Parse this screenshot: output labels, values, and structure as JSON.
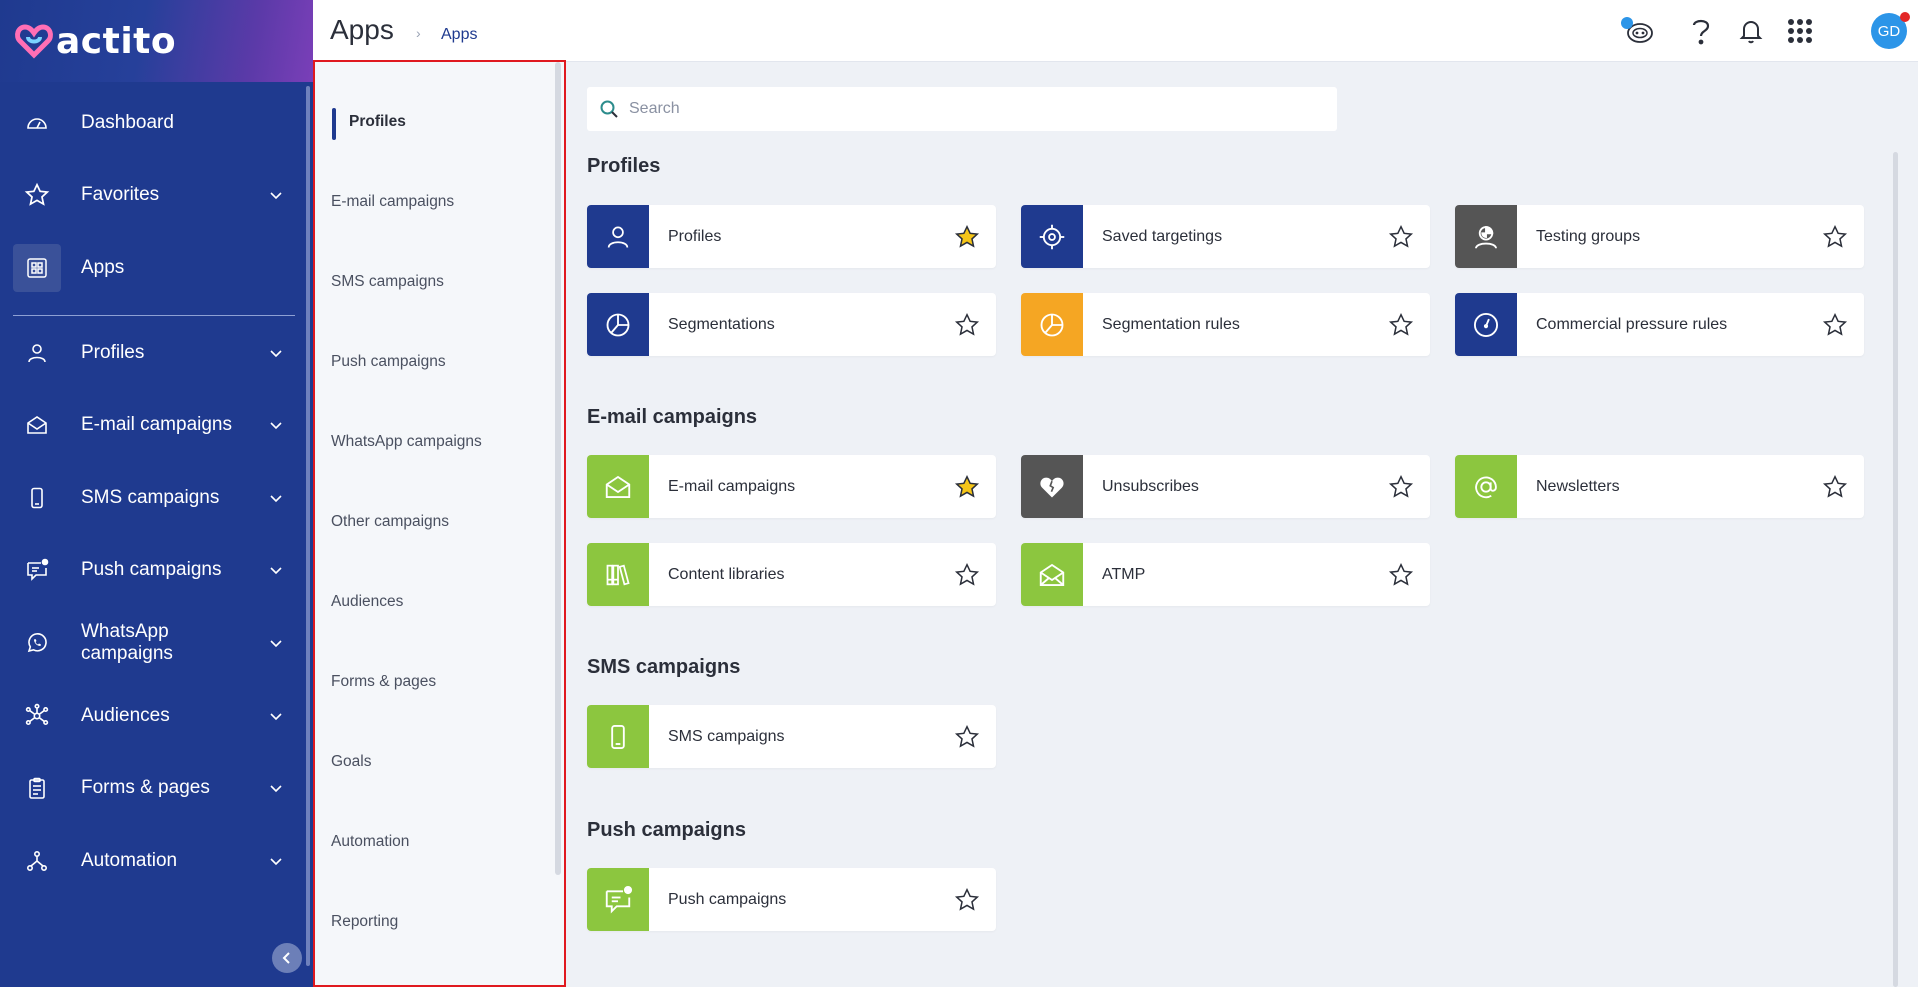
{
  "app": {
    "logo_text": "actito"
  },
  "sidebar": {
    "items": [
      {
        "label": "Dashboard",
        "icon": "gauge-icon"
      },
      {
        "label": "Favorites",
        "icon": "star-icon"
      },
      {
        "label": "Apps",
        "icon": "apps-grid-icon"
      },
      {
        "label": "Profiles",
        "icon": "user-icon"
      },
      {
        "label": "E-mail campaigns",
        "icon": "envelope-icon"
      },
      {
        "label": "SMS campaigns",
        "icon": "phone-icon"
      },
      {
        "label": "Push campaigns",
        "icon": "push-message-icon"
      },
      {
        "label": "WhatsApp campaigns",
        "icon": "whatsapp-icon"
      },
      {
        "label": "Audiences",
        "icon": "network-icon"
      },
      {
        "label": "Forms & pages",
        "icon": "clipboard-icon"
      },
      {
        "label": "Automation",
        "icon": "flow-icon"
      }
    ],
    "active_item": "Apps"
  },
  "header": {
    "title": "Apps",
    "breadcrumb": "Apps",
    "avatar_initials": "GD",
    "notification_badge_color": "#e32727"
  },
  "categories": {
    "items": [
      "Profiles",
      "E-mail campaigns",
      "SMS campaigns",
      "Push campaigns",
      "WhatsApp campaigns",
      "Other campaigns",
      "Audiences",
      "Forms & pages",
      "Goals",
      "Automation",
      "Reporting"
    ],
    "active": "Profiles"
  },
  "search": {
    "placeholder": "Search",
    "value": ""
  },
  "sections": [
    {
      "title": "Profiles",
      "cards": [
        {
          "label": "Profiles",
          "icon": "user-icon",
          "color": "#1f3a8f",
          "favorite": true
        },
        {
          "label": "Saved targetings",
          "icon": "target-icon",
          "color": "#1f3a8f",
          "favorite": false
        },
        {
          "label": "Testing groups",
          "icon": "testing-group-icon",
          "color": "#555555",
          "favorite": false
        },
        {
          "label": "Segmentations",
          "icon": "pie-chart-icon",
          "color": "#1f3a8f",
          "favorite": false
        },
        {
          "label": "Segmentation rules",
          "icon": "pie-chart-icon",
          "color": "#f5a623",
          "favorite": false
        },
        {
          "label": "Commercial pressure rules",
          "icon": "speedometer-icon",
          "color": "#1f3a8f",
          "favorite": false
        }
      ]
    },
    {
      "title": "E-mail campaigns",
      "cards": [
        {
          "label": "E-mail campaigns",
          "icon": "envelope-icon",
          "color": "#8cc63f",
          "favorite": true
        },
        {
          "label": "Unsubscribes",
          "icon": "broken-heart-icon",
          "color": "#555555",
          "favorite": false
        },
        {
          "label": "Newsletters",
          "icon": "at-sign-icon",
          "color": "#8cc63f",
          "favorite": false
        },
        {
          "label": "Content libraries",
          "icon": "library-icon",
          "color": "#8cc63f",
          "favorite": false
        },
        {
          "label": "ATMP",
          "icon": "envelope-open-icon",
          "color": "#8cc63f",
          "favorite": false
        }
      ]
    },
    {
      "title": "SMS campaigns",
      "cards": [
        {
          "label": "SMS campaigns",
          "icon": "phone-icon",
          "color": "#8cc63f",
          "favorite": false
        }
      ]
    },
    {
      "title": "Push campaigns",
      "cards": [
        {
          "label": "Push campaigns",
          "icon": "push-message-icon",
          "color": "#8cc63f",
          "favorite": false
        }
      ]
    }
  ],
  "colors": {
    "sidebar_bg": "#1f3a8f",
    "accent": "#1f3a8f",
    "favorite_star": "#f5c518",
    "highlight_border": "#e0191f"
  }
}
